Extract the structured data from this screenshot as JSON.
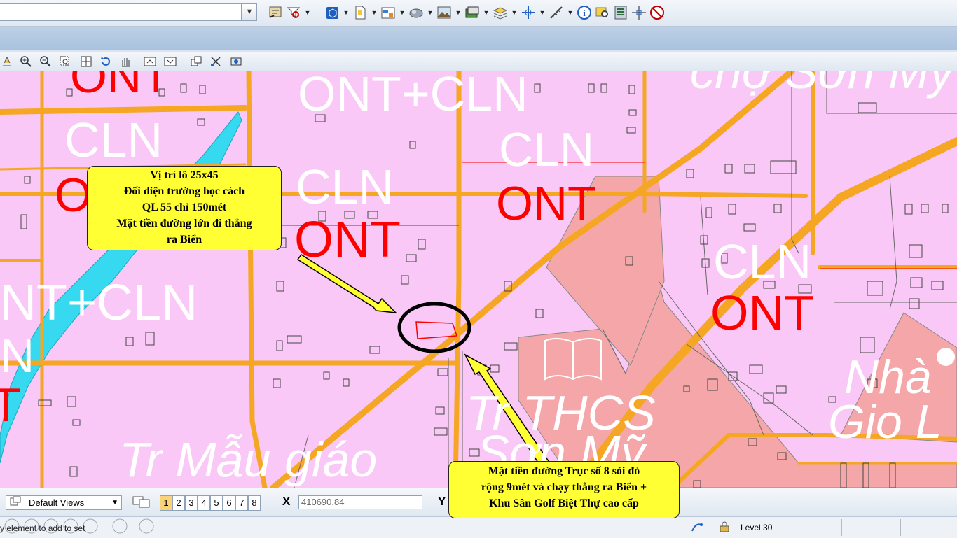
{
  "toolbar": {
    "level_combo_value": "",
    "icons": [
      "navigate-icon",
      "accudraw-icon",
      "cube-icon",
      "document-icon",
      "view-attributes-icon",
      "render-icon",
      "terrain-icon",
      "raster-icon",
      "levels-icon",
      "snaps-icon",
      "measure-icon",
      "info-icon",
      "search-icon",
      "models-icon",
      "crosshair-icon",
      "disable-icon"
    ]
  },
  "view_toolbar_icons": [
    "print-icon",
    "zoom-in-icon",
    "zoom-out-icon",
    "window-area-icon",
    "fit-view-icon",
    "rotate-icon",
    "pan-icon",
    "view-previous-icon",
    "view-next-icon",
    "copy-view-icon",
    "clip-icon",
    "view-settings-icon"
  ],
  "map": {
    "labels": {
      "ont_top_left": "ONT",
      "ont_cln_top": "ONT+CLN",
      "cho_top_right": "chợ Sơn Mỹ",
      "cln_left": "CLN",
      "cln_center": "CLN",
      "cln_right_top": "CLN",
      "ont_left_cut": "ONT",
      "ont_center": "ONT",
      "ont_right_top": "ONT",
      "cln_right": "CLN",
      "ont_right": "ONT",
      "ont_cln_left": "NT+CLN",
      "n_left": "N",
      "t_left": "T",
      "nha_gio": "Nhà",
      "gio_l": "Gio L",
      "tr_thcs": "Tr THCS",
      "son_my": "Sơn Mỹ",
      "tr_mau_giao": "Tr Mẫu giáo"
    },
    "callout_top": {
      "line1": "Vị trí lô 25x45",
      "line2": "Đối diện trường học cách",
      "line3": "QL 55 chỉ 150mét",
      "line4": "Mặt tiền đường lớn đi thẳng",
      "line5": "ra Biển"
    },
    "callout_bottom": {
      "line1": "Mặt tiền đường Trục số 8 sỏi đỏ",
      "line2": "rộng 9mét và chạy thẳng ra Biển +",
      "line3": "Khu Sân Golf Biệt Thự cao cấp"
    },
    "colors": {
      "land": "#f9c8f6",
      "school_zone": "#f4a6a8",
      "road": "#f5a623",
      "river": "#36d9f0",
      "label_red": "#ff0000",
      "callout": "#ffff33"
    }
  },
  "bottom_bar": {
    "views_label": "Default Views",
    "view_numbers": [
      "1",
      "2",
      "3",
      "4",
      "5",
      "6",
      "7",
      "8"
    ],
    "x_label": "X",
    "x_value": "410690.84",
    "y_label": "Y"
  },
  "status_bar": {
    "prompt": "y element to add to set",
    "level": "Level 30"
  }
}
